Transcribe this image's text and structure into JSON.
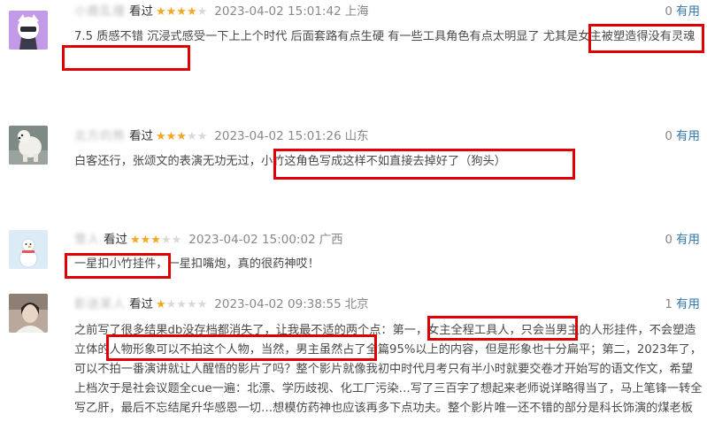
{
  "reviews": [
    {
      "username": "小鹿乱撞",
      "watched": "看过",
      "rating": 4,
      "time": "2023-04-02 15:01:42",
      "location": "上海",
      "votes": "0",
      "useful_label": "有用",
      "content": "7.5 质感不错 沉浸式感受一下上上个时代 后面套路有点生硬 有一些工具角色有点太明显了 尤其是女主被塑造得没有灵魂"
    },
    {
      "username": "北方的熊",
      "watched": "看过",
      "rating": 3,
      "time": "2023-04-02 15:01:26",
      "location": "山东",
      "votes": "0",
      "useful_label": "有用",
      "content": "白客还行，张颂文的表演无功无过，小竹这角色写成这样不如直接去掉好了（狗头）"
    },
    {
      "username": "雪人",
      "watched": "看过",
      "rating": 3,
      "time": "2023-04-02 15:00:02",
      "location": "广西",
      "votes": "0",
      "useful_label": "有用",
      "content": "一星扣小竹挂件，一星扣嘴炮，真的很药神哎！"
    },
    {
      "username": "影迷某人",
      "watched": "看过",
      "rating": 1,
      "time": "2023-04-02 09:38:55",
      "location": "北京",
      "votes": "1",
      "useful_label": "有用",
      "content": "之前写了很多结果db没存档都消失了，让我最不适的两个点：第一，女主全程工具人，只会当男主的人形挂件，不会塑造立体的人物形象可以不拍这个人物，当然，男主虽然占了全篇95%以上的内容，但是形象也十分扁平；第二，2023年了，可以不拍一番演讲就让人醒悟的影片了吗？整个影片就像我初中时代月考只有半小时就要交卷才开始写的语文作文，希望上档次于是社会议题全cue一遍：北漂、学历歧视、化工厂污染…写了三百字了想起来老师说详略得当了，马上笔锋一转全写乙肝，最后不忘结尾升华感恩一切…想模仿药神也应该再多下点功夫。整个影片唯一还不错的部分是科长饰演的煤老板"
    }
  ]
}
